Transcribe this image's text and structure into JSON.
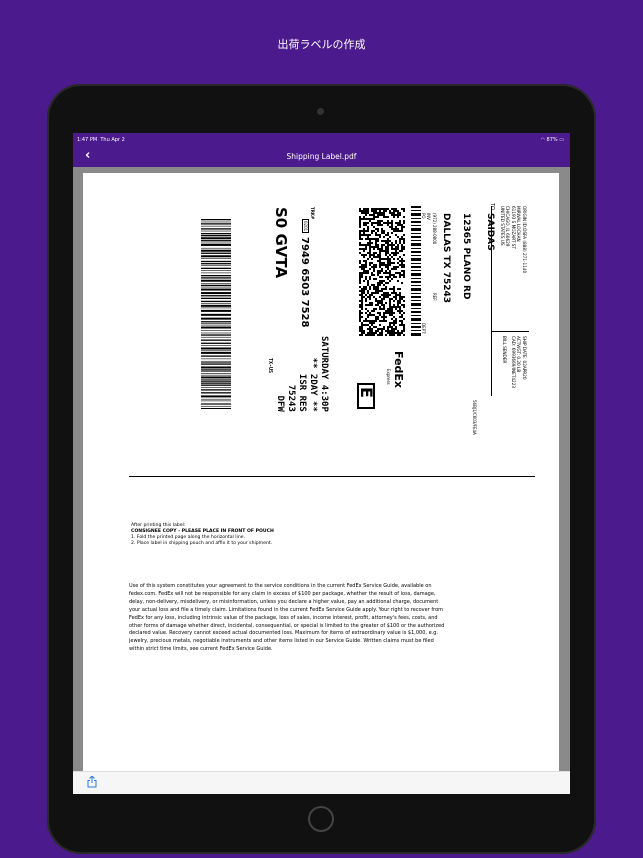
{
  "caption": "出荷ラベルの作成",
  "status": {
    "time": "1:47 PM",
    "date": "Thu Apr 2",
    "battery": "87%"
  },
  "nav": {
    "back": "‹",
    "title": "Shipping Label.pdf"
  },
  "label": {
    "origin": "ORIGIN ID:DSFA   (888) 271-1140",
    "sender_name": "MIRWAL LOCHAN",
    "sender_street": "61193 S MOZART ST",
    "sender_city": "CHICAGO, IL 60629",
    "sender_country": "UNITED STATES US",
    "ship_date": "SHIP DATE: 02APR20",
    "weight": "ACTWGT: 0.20 LB",
    "cad": "CAD: 6993669/INET4223",
    "bill": "BILL SENDER",
    "to_prefix": "TO",
    "recipient": "SAIDAS",
    "recipient_street": "12365 PLANO RD",
    "recipient_city": "DALLAS TX 75243",
    "phone": "(972) 288-0800",
    "ref": "REF:",
    "inv": "INV",
    "po": "PO",
    "dept": "DEPT:",
    "ref_code": "56BJ1/C603/FE4A",
    "fedex": "FedEx",
    "express": "Express",
    "e_box": "E",
    "trk_label": "TRK#",
    "trk_code": "0201",
    "tracking": "7949 6503 7528",
    "service_day": "SATURDAY 4:30P",
    "service": "** 2DAY **",
    "isr": "ISR RES",
    "zip": "75243",
    "route": "S0 GVTA",
    "state": "TX-US",
    "airport": "DFW"
  },
  "instructions": {
    "line1": "After printing this label:",
    "line2": "CONSIGNEE COPY - PLEASE PLACE IN FRONT OF POUCH",
    "line3": "1. Fold the printed page along the horizontal line.",
    "line4": "2. Place label in shipping pouch and affix it to your shipment."
  },
  "terms": [
    "Use of this system constitutes your agreement to the service conditions in the current FedEx Service Guide, available on",
    "fedex.com. FedEx will not be responsible for any claim in excess of $100 per package, whether the result of loss, damage,",
    "delay, non-delivery, misdelivery, or misinformation, unless you declare a higher value, pay an additional charge, document",
    "your actual loss and file a timely claim. Limitations found in the current FedEx Service Guide apply. Your right to recover from",
    "FedEx for any loss, including intrinsic value of the package, loss of sales, income interest, profit, attorney's fees, costs, and",
    "other forms of damage whether direct, incidental, consequential, or special is limited to the greater of $100 or the authorized",
    "declared value. Recovery cannot exceed actual documented loss. Maximum for items of extraordinary value is $1,000, e.g.",
    "jewelry, precious metals, negotiable instruments and other items listed in our Service Guide. Written claims must be filed",
    "within strict time limits, see current FedEx Service Guide."
  ]
}
